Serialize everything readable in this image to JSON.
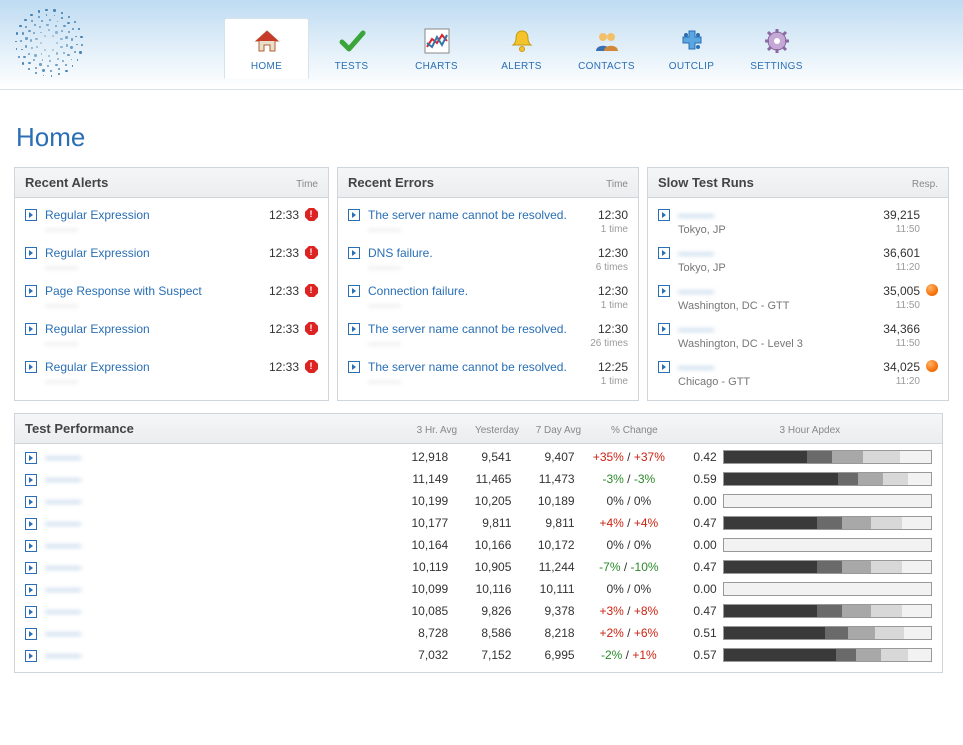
{
  "nav": [
    {
      "key": "home",
      "label": "HOME"
    },
    {
      "key": "tests",
      "label": "TESTS"
    },
    {
      "key": "charts",
      "label": "CHARTS"
    },
    {
      "key": "alerts",
      "label": "ALERTS"
    },
    {
      "key": "contacts",
      "label": "CONTACTS"
    },
    {
      "key": "outclip",
      "label": "OUTCLIP"
    },
    {
      "key": "settings",
      "label": "SETTINGS"
    }
  ],
  "active_nav": "home",
  "page_title": "Home",
  "panels": {
    "alerts": {
      "title": "Recent Alerts",
      "time_col": "Time",
      "items": [
        {
          "label": "Regular Expression",
          "sub": "———",
          "time": "12:33",
          "icon": "stop"
        },
        {
          "label": "Regular Expression",
          "sub": "———",
          "time": "12:33",
          "icon": "stop"
        },
        {
          "label": "Page Response with Suspect",
          "sub": "———",
          "time": "12:33",
          "icon": "stop"
        },
        {
          "label": "Regular Expression",
          "sub": "———",
          "time": "12:33",
          "icon": "stop"
        },
        {
          "label": "Regular Expression",
          "sub": "———",
          "time": "12:33",
          "icon": "stop"
        }
      ]
    },
    "errors": {
      "title": "Recent Errors",
      "time_col": "Time",
      "items": [
        {
          "label": "The server name cannot be resolved.",
          "sub": "———",
          "time": "12:30",
          "count": "1 time"
        },
        {
          "label": "DNS failure.",
          "sub": "———",
          "time": "12:30",
          "count": "6 times"
        },
        {
          "label": "Connection failure.",
          "sub": "———",
          "time": "12:30",
          "count": "1 time"
        },
        {
          "label": "The server name cannot be resolved.",
          "sub": "———",
          "time": "12:30",
          "count": "26 times"
        },
        {
          "label": "The server name cannot be resolved.",
          "sub": "———",
          "time": "12:25",
          "count": "1 time"
        }
      ]
    },
    "slow": {
      "title": "Slow Test Runs",
      "resp_col": "Resp.",
      "items": [
        {
          "label": "———",
          "location": "Tokyo, JP",
          "resp": "39,215",
          "time": "11:50",
          "dot": false
        },
        {
          "label": "———",
          "location": "Tokyo, JP",
          "resp": "36,601",
          "time": "11:20",
          "dot": false
        },
        {
          "label": "———",
          "location": "Washington, DC - GTT",
          "resp": "35,005",
          "time": "11:50",
          "dot": true
        },
        {
          "label": "———",
          "location": "Washington, DC - Level 3",
          "resp": "34,366",
          "time": "11:50",
          "dot": false
        },
        {
          "label": "———",
          "location": "Chicago - GTT",
          "resp": "34,025",
          "time": "11:20",
          "dot": true
        }
      ]
    }
  },
  "perf": {
    "title": "Test Performance",
    "cols": {
      "h3": "3 Hr. Avg",
      "yest": "Yesterday",
      "d7": "7 Day Avg",
      "chg": "% Change",
      "apdex": "3 Hour Apdex"
    },
    "rows": [
      {
        "name": "———",
        "h3": "12,918",
        "y": "9,541",
        "d7": "9,407",
        "c1": "+35%",
        "c1c": "pos",
        "c2": "+37%",
        "c2c": "pos",
        "apdex": "0.42",
        "bar": [
          40,
          12,
          15,
          18,
          15
        ]
      },
      {
        "name": "———",
        "h3": "11,149",
        "y": "11,465",
        "d7": "11,473",
        "c1": "-3%",
        "c1c": "neg",
        "c2": "-3%",
        "c2c": "neg",
        "apdex": "0.59",
        "bar": [
          55,
          10,
          12,
          12,
          11
        ]
      },
      {
        "name": "———",
        "h3": "10,199",
        "y": "10,205",
        "d7": "10,189",
        "c1": "0%",
        "c1c": "zero",
        "c2": "0%",
        "c2c": "zero",
        "apdex": "0.00",
        "bar": [
          0,
          0,
          0,
          0,
          100
        ]
      },
      {
        "name": "———",
        "h3": "10,177",
        "y": "9,811",
        "d7": "9,811",
        "c1": "+4%",
        "c1c": "pos",
        "c2": "+4%",
        "c2c": "pos",
        "apdex": "0.47",
        "bar": [
          45,
          12,
          14,
          15,
          14
        ]
      },
      {
        "name": "———",
        "h3": "10,164",
        "y": "10,166",
        "d7": "10,172",
        "c1": "0%",
        "c1c": "zero",
        "c2": "0%",
        "c2c": "zero",
        "apdex": "0.00",
        "bar": [
          0,
          0,
          0,
          0,
          100
        ]
      },
      {
        "name": "———",
        "h3": "10,119",
        "y": "10,905",
        "d7": "11,244",
        "c1": "-7%",
        "c1c": "neg",
        "c2": "-10%",
        "c2c": "neg",
        "apdex": "0.47",
        "bar": [
          45,
          12,
          14,
          15,
          14
        ]
      },
      {
        "name": "———",
        "h3": "10,099",
        "y": "10,116",
        "d7": "10,111",
        "c1": "0%",
        "c1c": "zero",
        "c2": "0%",
        "c2c": "zero",
        "apdex": "0.00",
        "bar": [
          0,
          0,
          0,
          0,
          100
        ]
      },
      {
        "name": "———",
        "h3": "10,085",
        "y": "9,826",
        "d7": "9,378",
        "c1": "+3%",
        "c1c": "pos",
        "c2": "+8%",
        "c2c": "pos",
        "apdex": "0.47",
        "bar": [
          45,
          12,
          14,
          15,
          14
        ]
      },
      {
        "name": "———",
        "h3": "8,728",
        "y": "8,586",
        "d7": "8,218",
        "c1": "+2%",
        "c1c": "pos",
        "c2": "+6%",
        "c2c": "pos",
        "apdex": "0.51",
        "bar": [
          49,
          11,
          13,
          14,
          13
        ]
      },
      {
        "name": "———",
        "h3": "7,032",
        "y": "7,152",
        "d7": "6,995",
        "c1": "-2%",
        "c1c": "neg",
        "c2": "+1%",
        "c2c": "pos",
        "apdex": "0.57",
        "bar": [
          54,
          10,
          12,
          13,
          11
        ]
      }
    ]
  }
}
